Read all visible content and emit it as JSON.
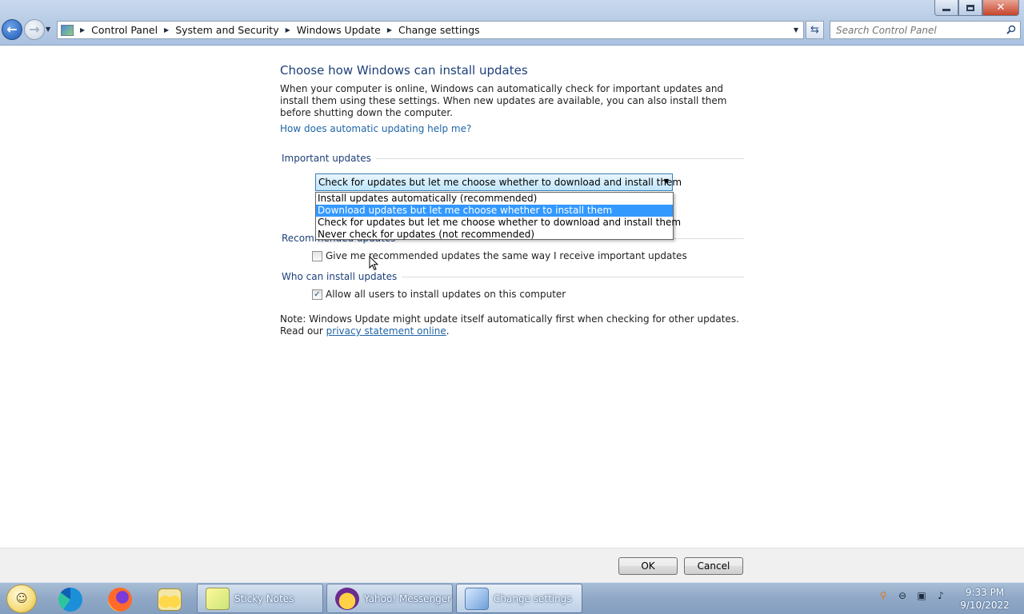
{
  "window": {
    "minimize_icon": "minimize-icon",
    "restore_icon": "restore-icon",
    "close_icon": "close-icon"
  },
  "address": {
    "breadcrumbs": [
      "Control Panel",
      "System and Security",
      "Windows Update",
      "Change settings"
    ],
    "search_placeholder": "Search Control Panel"
  },
  "main": {
    "heading": "Choose how Windows can install updates",
    "intro": "When your computer is online, Windows can automatically check for important updates and install them using these settings. When new updates are available, you can also install them before shutting down the computer.",
    "help_link": "How does automatic updating help me?",
    "important_updates": {
      "title": "Important updates",
      "selected_value": "Check for updates but let me choose whether to download and install them",
      "options": [
        "Install updates automatically (recommended)",
        "Download updates but let me choose whether to install them",
        "Check for updates but let me choose whether to download and install them",
        "Never check for updates (not recommended)"
      ],
      "highlighted_index": 1
    },
    "recommended_updates": {
      "title": "Recommended updates",
      "checkbox_label": "Give me recommended updates the same way I receive important updates",
      "checked": false
    },
    "who_can_install": {
      "title": "Who can install updates",
      "checkbox_label": "Allow all users to install updates on this computer",
      "checked": true
    },
    "note_text": "Note: Windows Update might update itself automatically first when checking for other updates.  Read our ",
    "privacy_link": "privacy statement online",
    "note_end": "."
  },
  "buttons": {
    "ok": "OK",
    "cancel": "Cancel"
  },
  "taskbar": {
    "tasks": [
      {
        "label": "Sticky Notes"
      },
      {
        "label": "Yahoo! Messenger"
      },
      {
        "label": "Change settings"
      }
    ],
    "clock_time": "9:33 PM",
    "clock_date": "9/10/2022"
  },
  "colors": {
    "link": "#1f65a7",
    "heading": "#1d3f78",
    "selection": "#3399ff"
  }
}
